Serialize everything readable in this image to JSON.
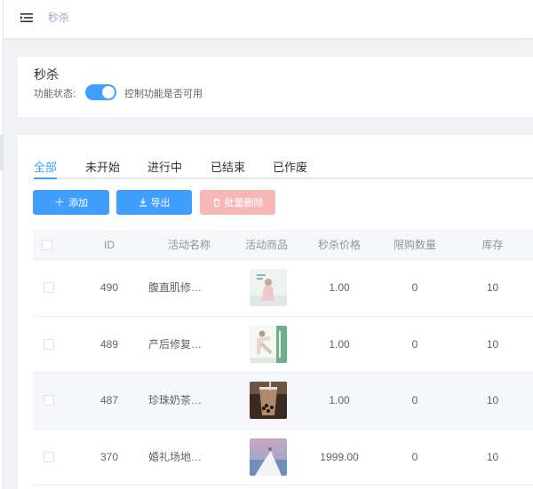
{
  "header": {
    "breadcrumb": "秒杀",
    "menu_icon": "menu-fold-icon"
  },
  "settings": {
    "title": "秒杀",
    "status_label": "功能状态:",
    "switch_on": true,
    "hint": "控制功能是否可用"
  },
  "tabs": [
    {
      "label": "全部",
      "active": true
    },
    {
      "label": "未开始",
      "active": false
    },
    {
      "label": "进行中",
      "active": false
    },
    {
      "label": "已结束",
      "active": false
    },
    {
      "label": "已作废",
      "active": false
    }
  ],
  "toolbar": {
    "add_label": "添加",
    "export_label": "导出",
    "batch_delete_label": "批量删除"
  },
  "table": {
    "headers": [
      "ID",
      "活动名称",
      "活动商品",
      "秒杀价格",
      "限购数量",
      "库存"
    ],
    "rows": [
      {
        "id": "490",
        "name": "腹直肌修…",
        "product_image": "yoga-book-cover",
        "price": "1.00",
        "limit": "0",
        "stock": "10"
      },
      {
        "id": "489",
        "name": "产后修复…",
        "product_image": "postnatal-yoga-cover",
        "price": "1.00",
        "limit": "0",
        "stock": "10"
      },
      {
        "id": "487",
        "name": "珍珠奶茶…",
        "product_image": "bubble-tea-photo",
        "price": "1.00",
        "limit": "0",
        "stock": "10"
      },
      {
        "id": "370",
        "name": "婚礼场地…",
        "product_image": "wedding-venue-photo",
        "price": "1999.00",
        "limit": "0",
        "stock": "10"
      }
    ]
  },
  "colors": {
    "primary": "#409eff",
    "danger_disabled": "#f7b7b7",
    "text": "#303133",
    "muted": "#909399"
  }
}
